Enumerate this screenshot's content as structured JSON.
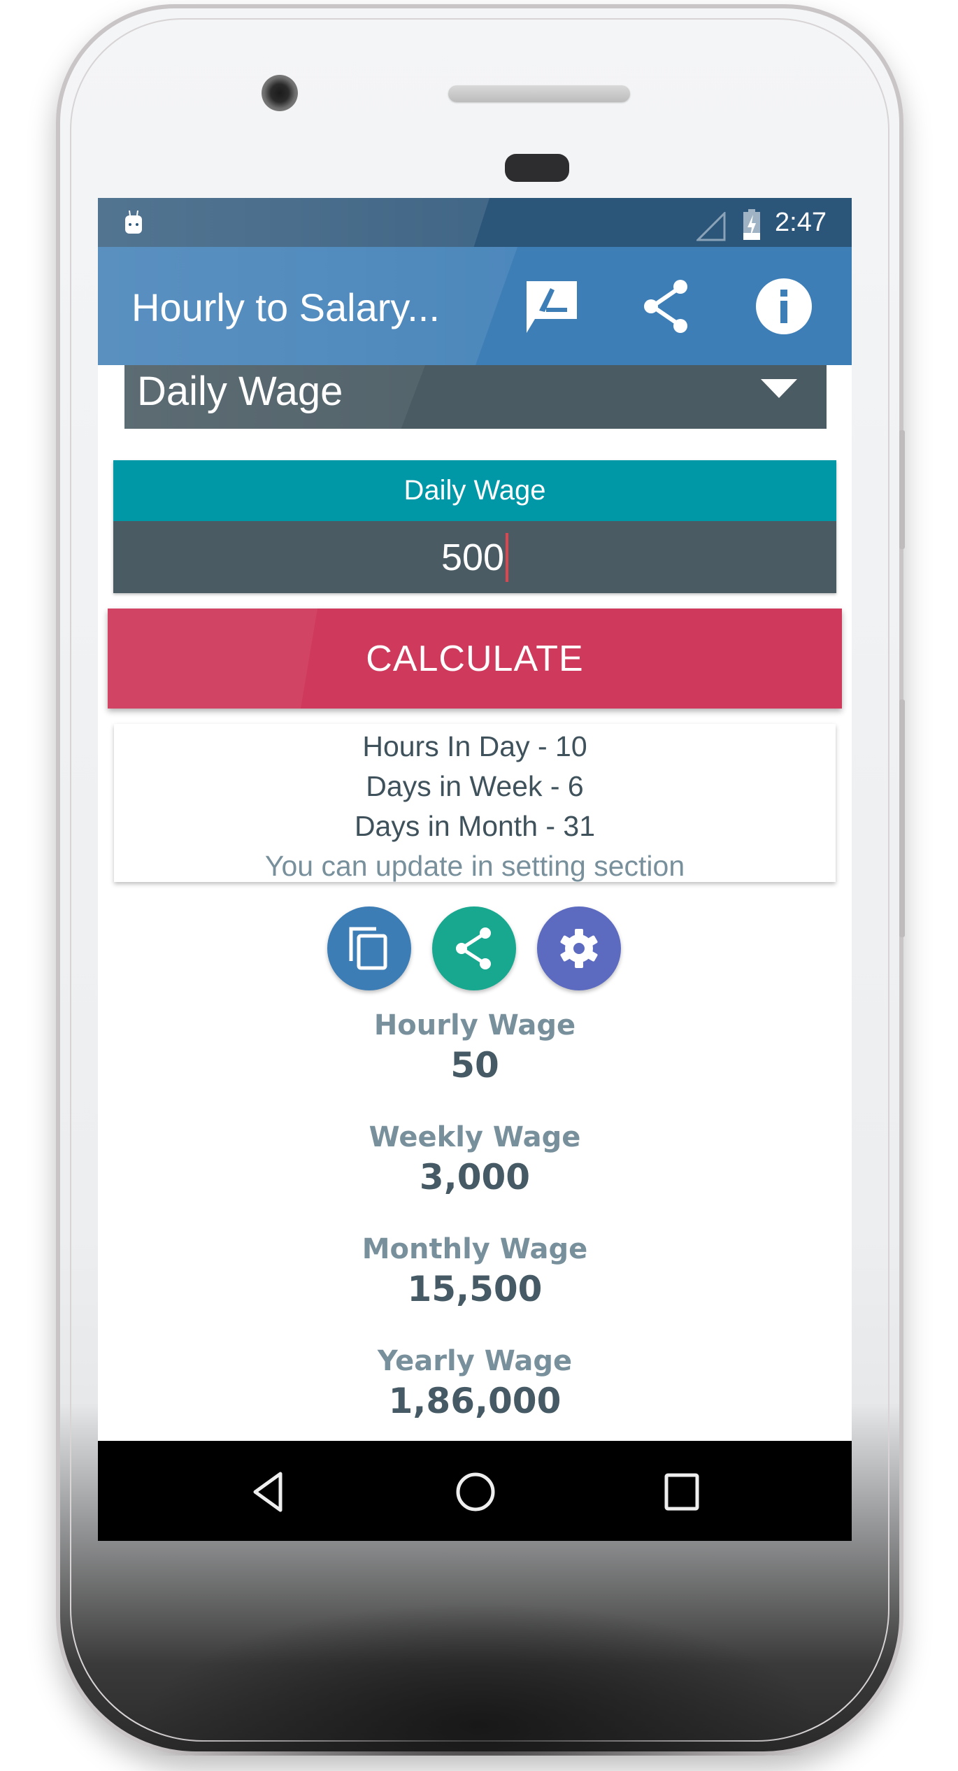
{
  "status_bar": {
    "time": "2:47",
    "icons": [
      "android-notification-icon",
      "signal-icon",
      "battery-charging-icon"
    ]
  },
  "toolbar": {
    "title": "Hourly to Salary...",
    "actions": [
      {
        "name": "feedback-icon",
        "label": "Feedback"
      },
      {
        "name": "share-icon",
        "label": "Share"
      },
      {
        "name": "info-icon",
        "label": "Info"
      }
    ],
    "color": "#3e7eb6"
  },
  "spinner": {
    "selected": "Daily Wage"
  },
  "input_field": {
    "label": "Daily Wage",
    "value": "500"
  },
  "calculate_button": {
    "label": "CALCULATE",
    "color": "#cf3a5c"
  },
  "info_card": {
    "lines": [
      "Hours In Day - 10",
      "Days in Week - 6",
      "Days in Month - 31"
    ],
    "note": "You can update in setting section"
  },
  "fab_buttons": [
    {
      "name": "copy-icon",
      "color": "#3d7db5"
    },
    {
      "name": "share-icon",
      "color": "#17a88f"
    },
    {
      "name": "settings-icon",
      "color": "#5c6bc0"
    }
  ],
  "results": [
    {
      "label": "Hourly Wage",
      "value": "50"
    },
    {
      "label": "Weekly Wage",
      "value": "3,000"
    },
    {
      "label": "Monthly Wage",
      "value": "15,500"
    },
    {
      "label": "Yearly Wage",
      "value": "1,86,000"
    }
  ],
  "nav_bar": {
    "buttons": [
      "back-icon",
      "home-icon",
      "recents-icon"
    ]
  }
}
